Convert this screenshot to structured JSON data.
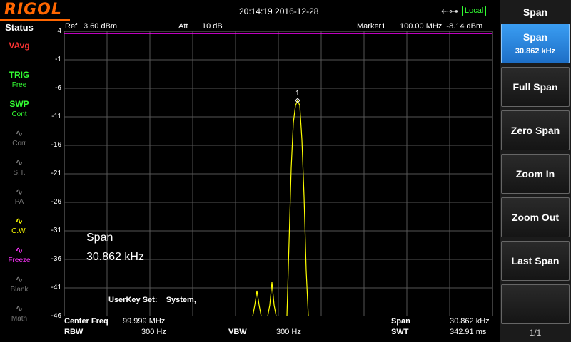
{
  "brand": "RIGOL",
  "datetime": "20:14:19 2016-12-28",
  "local_label": "Local",
  "status": {
    "title": "Status",
    "items": [
      {
        "icon": "VAvg",
        "label": ""
      },
      {
        "icon": "TRIG",
        "label": "Free"
      },
      {
        "icon": "SWP",
        "label": "Cont"
      },
      {
        "icon": "",
        "label": "Corr"
      },
      {
        "icon": "",
        "label": "S.T."
      },
      {
        "icon": "",
        "label": "PA"
      },
      {
        "icon": "",
        "label": "C.W."
      },
      {
        "icon": "",
        "label": "Freeze"
      },
      {
        "icon": "",
        "label": "Blank"
      },
      {
        "icon": "",
        "label": "Math"
      }
    ]
  },
  "header": {
    "ref_label": "Ref",
    "ref_value": "3.60 dBm",
    "att_label": "Att",
    "att_value": "10 dB",
    "marker_label": "Marker1",
    "marker_value": "100.00 MHz  -8.14 dBm"
  },
  "footer": {
    "center_label": "Center Freq",
    "center_value": "99.999 MHz",
    "span_label": "Span",
    "span_value": "30.862 kHz",
    "rbw_label": "RBW",
    "rbw_value": "300 Hz",
    "vbw_label": "VBW",
    "vbw_value": "300 Hz",
    "swt_label": "SWT",
    "swt_value": "342.91 ms"
  },
  "overlay": {
    "span_label": "Span",
    "span_value": "30.862 kHz",
    "userkey": "UserKey Set:    System,"
  },
  "menu": {
    "title": "Span",
    "keys": [
      {
        "label": "Span",
        "sub": "30.862 kHz",
        "active": true
      },
      {
        "label": "Full Span",
        "sub": ""
      },
      {
        "label": "Zero Span",
        "sub": ""
      },
      {
        "label": "Zoom In",
        "sub": ""
      },
      {
        "label": "Zoom Out",
        "sub": ""
      },
      {
        "label": "Last Span",
        "sub": ""
      },
      {
        "label": "",
        "sub": ""
      }
    ],
    "page": "1/1"
  },
  "colors": {
    "trace": "#ffff00",
    "ref_line": "#ff00ff",
    "grid": "#555555",
    "brand": "#ff6600",
    "active_key": "#2a86e0"
  },
  "chart_data": {
    "type": "line",
    "y_ticks": [
      "4",
      "-1",
      "-6",
      "-11",
      "-16",
      "-21",
      "-26",
      "-31",
      "-36",
      "-41",
      "-46"
    ],
    "ylim": [
      -46,
      4
    ],
    "ref_level_dbm": 3.6,
    "marker": {
      "label": "1",
      "x_fraction": 0.545,
      "value_dbm": -8.14
    },
    "trace": {
      "x_fraction": [
        0.44,
        0.445,
        0.45,
        0.455,
        0.46,
        0.475,
        0.48,
        0.485,
        0.49,
        0.495,
        0.5,
        0.52,
        0.525,
        0.53,
        0.535,
        0.54,
        0.545,
        0.55,
        0.555,
        0.56,
        0.565,
        0.57,
        0.58,
        0.6,
        1.0
      ],
      "dbm": [
        -46,
        -44,
        -41.5,
        -44,
        -46,
        -46,
        -44,
        -40,
        -44,
        -46,
        -46,
        -46,
        -33,
        -20,
        -12,
        -9,
        -8.14,
        -9,
        -15,
        -25,
        -38,
        -46,
        -46,
        -46,
        -46
      ]
    }
  }
}
